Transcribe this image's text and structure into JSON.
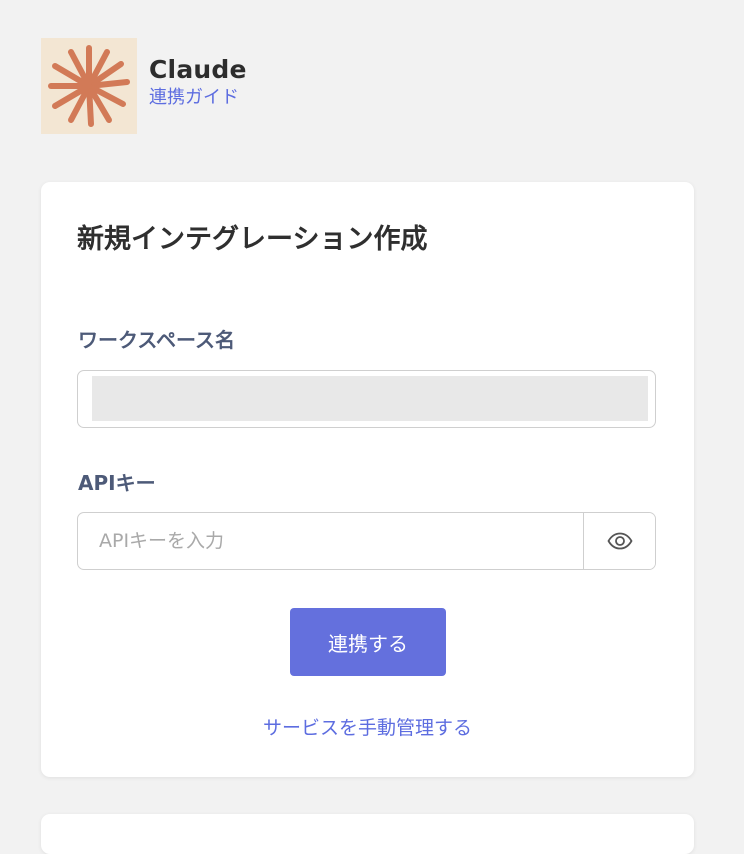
{
  "app": {
    "name": "Claude",
    "guide_link": "連携ガイド",
    "logo_icon": "claude-burst-logo",
    "logo_color": "#d27a57",
    "logo_bg": "#f3e6d3"
  },
  "form": {
    "title": "新規インテグレーション作成",
    "workspace_label": "ワークスペース名",
    "workspace_value": "",
    "api_label": "APIキー",
    "api_placeholder": "APIキーを入力",
    "api_value": "",
    "visibility_icon": "eye-icon",
    "submit_label": "連携する",
    "manual_link": "サービスを手動管理する"
  },
  "colors": {
    "accent": "#6470dd",
    "link": "#5d6de0",
    "label": "#4d5a78",
    "background": "#f2f2f2"
  }
}
